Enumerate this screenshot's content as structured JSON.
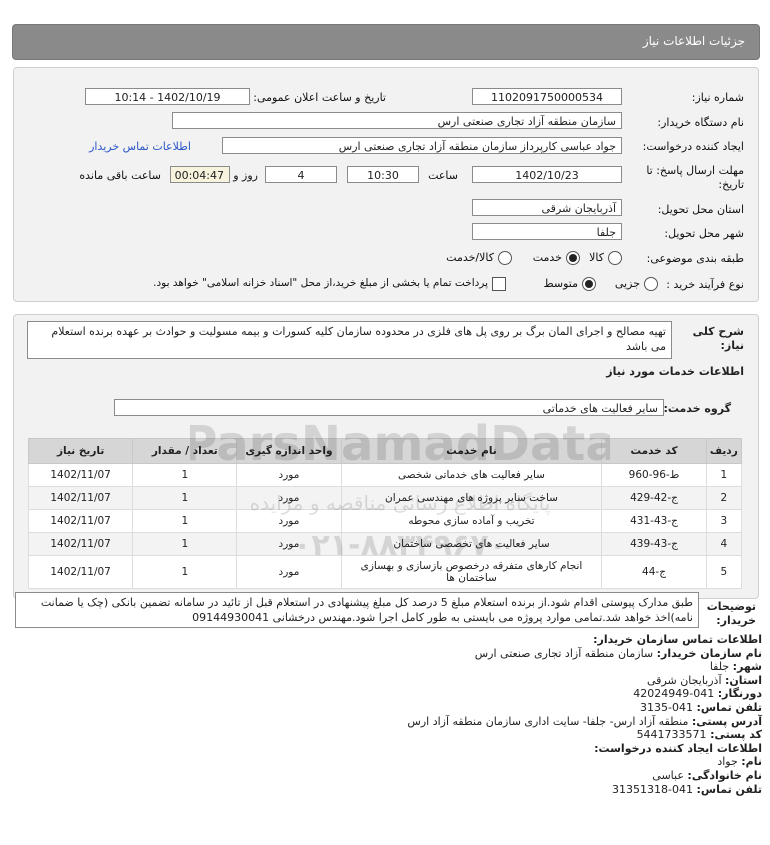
{
  "header": {
    "title": "جزئیات اطلاعات نیاز"
  },
  "form": {
    "need_number_label": "شماره نیاز:",
    "need_number": "1102091750000534",
    "announce_label": "تاریخ و ساعت اعلان عمومی:",
    "announce_value": "1402/10/19 - 10:14",
    "buyer_org_label": "نام دستگاه خریدار:",
    "buyer_org": "سازمان منطقه آزاد تجاری صنعتی ارس",
    "creator_label": "ایجاد کننده درخواست:",
    "creator": "جواد عباسی کارپرداز سازمان منطقه آزاد تجاری صنعتی ارس",
    "contact_link": "اطلاعات تماس خریدار",
    "deadline_label_1": "مهلت ارسال پاسخ: تا",
    "deadline_label_2": "تاریخ:",
    "deadline_date": "1402/10/23",
    "time_label": "ساعت",
    "deadline_time": "10:30",
    "days_value": "4",
    "days_label": "روز و",
    "remaining_time": "00:04:47",
    "remaining_label": "ساعت باقی مانده",
    "province_label": "استان محل تحویل:",
    "province": "آذربایجان شرقی",
    "city_label": "شهر محل تحویل:",
    "city": "جلفا",
    "category_label": "طبقه بندی موضوعی:",
    "category_options": [
      "کالا",
      "خدمت",
      "کالا/خدمت"
    ],
    "process_label": "نوع فرآیند خرید :",
    "process_options": [
      "جزیی",
      "متوسط"
    ],
    "payment_note": "پرداخت تمام یا بخشی از مبلغ خرید،از محل \"اسناد خزانه اسلامی\" خواهد بود."
  },
  "description": {
    "label_1": "شرح کلی",
    "label_2": "نیاز:",
    "text": "تهیه مصالح و اجرای المان برگ بر روی پل های فلزی در محدوده سازمان کلیه کسورات و بیمه مسولیت و حوادث بر عهده برنده استعلام می باشد",
    "services_title": "اطلاعات خدمات مورد نیاز",
    "service_group_label": "گروه خدمت:",
    "service_group": "سایر فعالیت های خدماتی"
  },
  "table": {
    "headers": [
      "ردیف",
      "کد خدمت",
      "نام خدمت",
      "واحد اندازه گیری",
      "تعداد / مقدار",
      "تاریخ نیاز"
    ],
    "rows": [
      [
        "1",
        "ط-96-960",
        "سایر فعالیت های خدماتی شخصی",
        "مورد",
        "1",
        "1402/11/07"
      ],
      [
        "2",
        "ج-42-429",
        "ساخت سایر پروژه های مهندسی عمران",
        "مورد",
        "1",
        "1402/11/07"
      ],
      [
        "3",
        "ج-43-431",
        "تخریب و آماده سازی محوطه",
        "مورد",
        "1",
        "1402/11/07"
      ],
      [
        "4",
        "ج-43-439",
        "سایر فعالیت های تخصصی ساختمان",
        "مورد",
        "1",
        "1402/11/07"
      ],
      [
        "5",
        "ج-44",
        "انجام کارهای متفرقه درخصوص بازسازی و بهسازی ساختمان ها",
        "مورد",
        "1",
        "1402/11/07"
      ]
    ]
  },
  "notes": {
    "label_1": "توضیحات",
    "label_2": "خریدار:",
    "text": "طبق مدارک پیوستی اقدام شود.از برنده استعلام مبلغ 5 درصد کل مبلغ پیشنهادی در استعلام قبل از تائید در سامانه تضمین بانکی (چک یا ضمانت نامه)اخذ خواهد شد.تمامی موارد پروژه می بایستی به طور کامل اجرا شود.مهندس درخشانی 09144930041"
  },
  "contact": {
    "title": "اطلاعات تماس سازمان خریدار:",
    "org_label": "نام سازمان خریدار:",
    "org": "سازمان منطقه آزاد تجاری صنعتی ارس",
    "city_label": "شهر:",
    "city": "جلفا",
    "province_label": "استان:",
    "province": "آذربایجان شرقی",
    "fax_label": "دورنگار:",
    "fax": "041-42024949",
    "phone_label": "تلفن تماس:",
    "phone": "041-3135",
    "address_label": "آدرس پستی:",
    "address": "منطقه آزاد ارس- جلفا- سایت اداری سازمان منطقه آزاد ارس",
    "postal_label": "کد پستی:",
    "postal": "5441733571",
    "creator_title": "اطلاعات ایجاد کننده درخواست:",
    "name_label": "نام:",
    "name": "جواد",
    "family_label": "نام خانوادگی:",
    "family": "عباسی",
    "creator_phone_label": "تلفن تماس:",
    "creator_phone": "041-31351318"
  },
  "watermark": {
    "text": "ParsNamadData",
    "sub": "پایگاه اطلاع رسانی مناقصه و مزایده",
    "phone": "۰۲۱-۸۸۳۴۹۶۷۰"
  }
}
